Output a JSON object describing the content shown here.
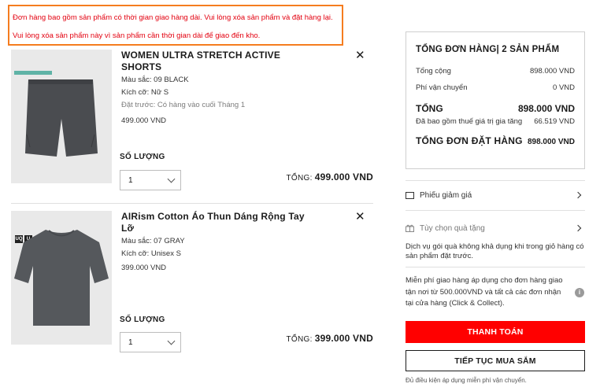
{
  "alert": {
    "line1": "Đơn hàng bao gồm sản phẩm có thời gian giao hàng dài. Vui lòng xóa sản phẩm và đặt hàng lại.",
    "line2": "Vui lòng xóa sản phẩm này vì sản phẩm cần thời gian dài để giao đến kho."
  },
  "items": [
    {
      "name": "WOMEN ULTRA STRETCH ACTIVE SHORTS",
      "color": "Màu sắc: 09 BLACK",
      "size": "Kích cỡ: Nữ S",
      "preorder": "Đặt trước: Có hàng vào cuối Tháng 1",
      "price": "499.000 VND",
      "qty_label": "SỐ LƯỢNG",
      "qty": "1",
      "total_label": "TỔNG:",
      "total": "499.000 VND",
      "image_color": "#4a4c50"
    },
    {
      "name": "AIRism Cotton Áo Thun Dáng Rộng Tay Lỡ",
      "color": "Màu sắc: 07 GRAY",
      "size": "Kích cỡ: Unisex S",
      "price": "399.000 VND",
      "qty_label": "SỐ LƯỢNG",
      "qty": "1",
      "total_label": "TỔNG:",
      "total": "399.000 VND",
      "image_color": "#55585c"
    }
  ],
  "summary": {
    "title": "TỔNG ĐƠN HÀNG| 2 SẢN PHẨM",
    "subtotal_label": "Tổng cộng",
    "subtotal": "898.000 VND",
    "shipping_label": "Phí vận chuyển",
    "shipping": "0 VND",
    "total_label": "TỔNG",
    "total": "898.000 VND",
    "tax_label": "Đã bao gồm thuế giá trị gia tăng",
    "tax": "66.519 VND",
    "grand_label": "TỔNG ĐƠN ĐẶT HÀNG",
    "grand": "898.000 VND"
  },
  "coupon_label": "Phiếu giảm giá",
  "gift_label": "Tùy chọn quà tặng",
  "gift_note": "Dịch vụ gói quà không khả dụng khi trong giỏ hàng có sản phẩm đặt trước.",
  "shipping_note": "Miễn phí giao hàng áp dụng cho đơn hàng giao tận nơi từ 500.000VND và tất cả các đơn nhận tại cửa hàng (Click & Collect).",
  "pay_button": "THANH TOÁN",
  "shop_button": "TIẾP TỤC MUA SẮM",
  "footnote": "Đủ điều kiện áp dụng miễn phí vận chuyển.",
  "colors": {
    "accent": "#ff0000",
    "alert_border": "#f57c1f",
    "alert_text": "#e3000f"
  }
}
